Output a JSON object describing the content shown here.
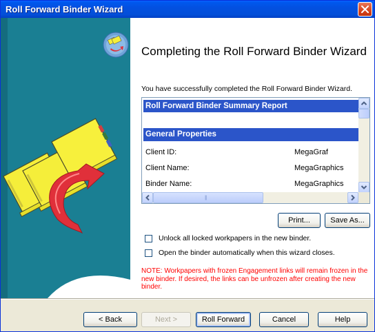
{
  "window": {
    "title": "Roll Forward Binder Wizard"
  },
  "heading": "Completing the Roll Forward Binder Wizard",
  "success_message": "You have successfully completed the Roll Forward Binder Wizard.",
  "report": {
    "title": "Roll Forward Binder Summary Report",
    "section": "General Properties",
    "rows": [
      {
        "label": "Client ID:",
        "value": "MegaGraf"
      },
      {
        "label": "Client Name:",
        "value": "MegaGraphics"
      },
      {
        "label": "Binder Name:",
        "value": "MegaGraphics"
      }
    ]
  },
  "buttons": {
    "print": "Print...",
    "save_as": "Save As...",
    "back": "< Back",
    "next": "Next >",
    "roll_forward": "Roll Forward",
    "cancel": "Cancel",
    "help": "Help"
  },
  "options": {
    "unlock_label": "Unlock all locked workpapers in the new binder.",
    "unlock_checked": false,
    "open_label": "Open the binder automatically when this wizard closes.",
    "open_checked": false
  },
  "note": "NOTE: Workpapers with frozen Engagement links will remain frozen in the new binder. If desired, the links can be unfrozen after creating the new binder.",
  "colors": {
    "title_bar": "#0054e3",
    "panel_teal": "#1a7f93",
    "binder_yellow": "#f5ee3a",
    "report_header": "#2b55c9",
    "note_red": "#ff0000"
  }
}
